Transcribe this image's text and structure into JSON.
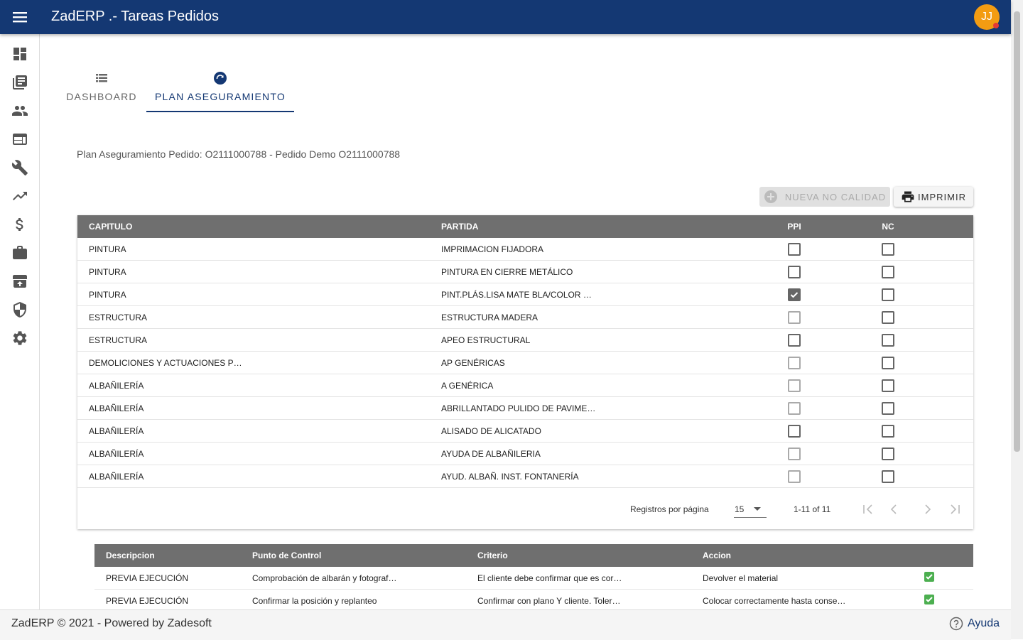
{
  "header": {
    "title": "ZadERP .- Tareas Pedidos",
    "avatar_initials": "JJ"
  },
  "sidebar": {
    "icons": [
      "dashboard-icon",
      "library-icon",
      "people-icon",
      "web-icon",
      "wrench-icon",
      "trending-up-icon",
      "dollar-icon",
      "briefcase-icon",
      "archive-icon",
      "shield-icon",
      "gear-icon"
    ]
  },
  "tabs": [
    {
      "label": "DASHBOARD"
    },
    {
      "label": "PLAN ASEGURAMIENTO",
      "active": true
    }
  ],
  "subtitle": "Plan Aseguramiento Pedido: O2111000788 - Pedido Demo O2111000788",
  "buttons": {
    "nueva_nc": "NUEVA NO CALIDAD",
    "imprimir": "IMPRIMIR"
  },
  "table1": {
    "headers": {
      "capitulo": "CAPITULO",
      "partida": "PARTIDA",
      "ppi": "PPI",
      "nc": "NC"
    },
    "rows": [
      {
        "capitulo": "PINTURA",
        "partida": "IMPRIMACION FIJADORA",
        "ppi": false,
        "nc": false,
        "ppi_light": false
      },
      {
        "capitulo": "PINTURA",
        "partida": "PINTURA EN CIERRE METÁLICO",
        "ppi": false,
        "nc": false,
        "ppi_light": false
      },
      {
        "capitulo": "PINTURA",
        "partida": "PINT.PLÁS.LISA MATE BLA/COLOR …",
        "ppi": true,
        "nc": false,
        "ppi_light": false
      },
      {
        "capitulo": "ESTRUCTURA",
        "partida": "ESTRUCTURA MADERA",
        "ppi": false,
        "nc": false,
        "ppi_light": true
      },
      {
        "capitulo": "ESTRUCTURA",
        "partida": "APEO ESTRUCTURAL",
        "ppi": false,
        "nc": false,
        "ppi_light": false
      },
      {
        "capitulo": "DEMOLICIONES Y ACTUACIONES P…",
        "partida": "AP GENÉRICAS",
        "ppi": false,
        "nc": false,
        "ppi_light": true
      },
      {
        "capitulo": "ALBAÑILERÍA",
        "partida": "A GENÉRICA",
        "ppi": false,
        "nc": false,
        "ppi_light": true
      },
      {
        "capitulo": "ALBAÑILERÍA",
        "partida": "ABRILLANTADO PULIDO DE PAVIME…",
        "ppi": false,
        "nc": false,
        "ppi_light": true
      },
      {
        "capitulo": "ALBAÑILERÍA",
        "partida": "ALISADO DE ALICATADO",
        "ppi": false,
        "nc": false,
        "ppi_light": false
      },
      {
        "capitulo": "ALBAÑILERÍA",
        "partida": "AYUDA DE ALBAÑILERIA",
        "ppi": false,
        "nc": false,
        "ppi_light": true
      },
      {
        "capitulo": "ALBAÑILERÍA",
        "partida": "AYUD. ALBAÑ. INST. FONTANERÍA",
        "ppi": false,
        "nc": false,
        "ppi_light": true
      }
    ]
  },
  "pager": {
    "label": "Registros por página",
    "per_page": "15",
    "range": "1-11 of 11"
  },
  "table2": {
    "headers": {
      "descripcion": "Descripcion",
      "punto": "Punto de Control",
      "criterio": "Criterio",
      "accion": "Accion"
    },
    "rows": [
      {
        "descripcion": "PREVIA EJECUCIÓN",
        "punto": "Comprobación de albarán y fotograf…",
        "criterio": "El cliente debe confirmar que es cor…",
        "accion": "Devolver el material"
      },
      {
        "descripcion": "PREVIA EJECUCIÓN",
        "punto": "Confirmar la posición y replanteo",
        "criterio": "Confirmar con plano Y cliente. Toler…",
        "accion": "Colocar correctamente hasta conse…"
      }
    ]
  },
  "footer": {
    "text": "ZadERP © 2021 - Powered by Zadesoft",
    "help": "Ayuda"
  },
  "colors": {
    "primary": "#143873",
    "avatar": "#f39c12",
    "table_header": "#6f6f6f",
    "check_green": "#4caf50"
  }
}
